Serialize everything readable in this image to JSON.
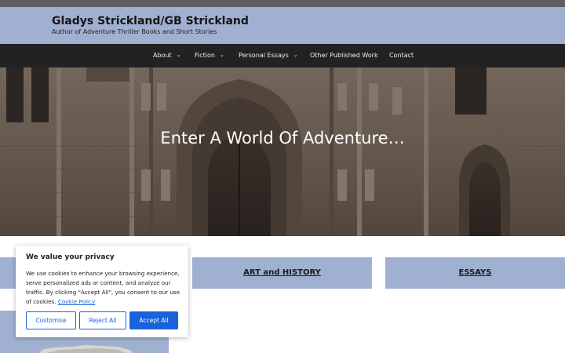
{
  "header": {
    "site_title": "Gladys Strickland/GB Strickland",
    "tagline": "Author of Adventure Thriller Books and Short Stories"
  },
  "nav": {
    "items": [
      {
        "label": "About",
        "has_dropdown": true
      },
      {
        "label": "Fiction",
        "has_dropdown": true
      },
      {
        "label": "Personal Essays",
        "has_dropdown": true
      },
      {
        "label": "Other Published Work",
        "has_dropdown": false
      },
      {
        "label": "Contact",
        "has_dropdown": false
      }
    ],
    "dropdown_icon": "chevron-down-icon"
  },
  "hero": {
    "title": "Enter A World Of Adventure…"
  },
  "cards": [
    {
      "label": ""
    },
    {
      "label": "ART and HISTORY"
    },
    {
      "label": "ESSAYS"
    }
  ],
  "cookie_banner": {
    "title": "We value your privacy",
    "body": "We use cookies to enhance your browsing experience, serve personalized ads or content, and analyze our traffic. By clicking \"Accept All\", you consent to our use of cookies.",
    "policy_link": "Cookie Policy",
    "buttons": {
      "customise": "Customise",
      "reject": "Reject All",
      "accept": "Accept All"
    }
  },
  "colors": {
    "header_bg": "#9fb0d0",
    "nav_bg": "#222222",
    "topbar": "#5f5f5f",
    "cookie_accent": "#1863dc"
  }
}
